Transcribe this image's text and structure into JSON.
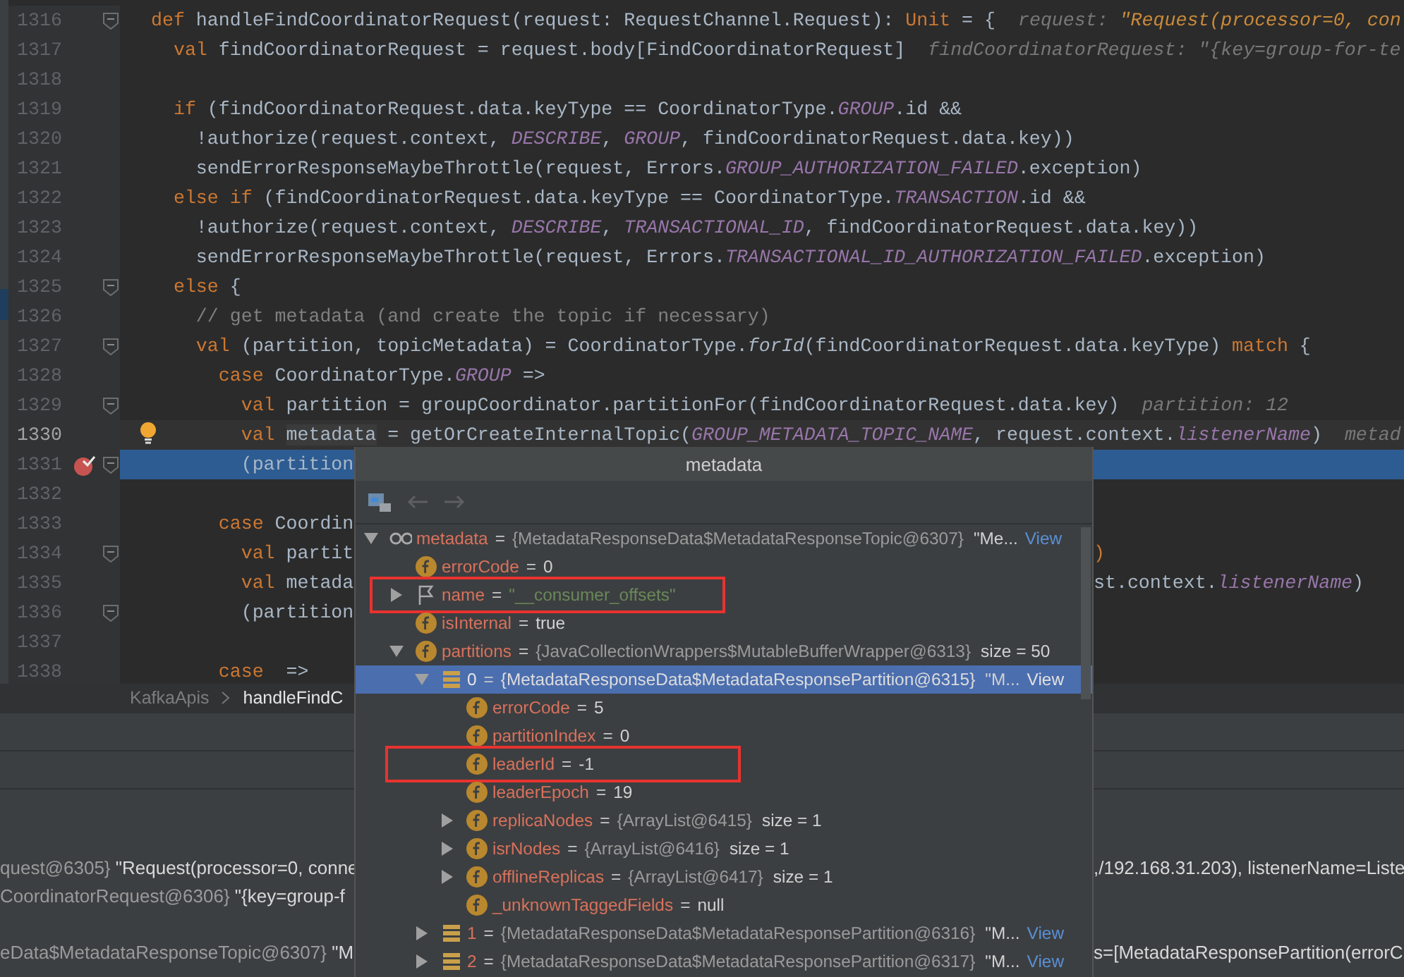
{
  "editor": {
    "lines": [
      {
        "number": "1316",
        "fold": true,
        "current_line": false,
        "execution_line": false,
        "breakpoint": false,
        "bulb": false,
        "tokens": [
          {
            "kind": "kw",
            "text": "def"
          },
          {
            "kind": "plain",
            "text": " handleFindCoordinatorRequest(request: RequestChannel.Request): "
          },
          {
            "kind": "kw",
            "text": "Unit"
          },
          {
            "kind": "plain",
            "text": " = {"
          }
        ],
        "hint": [
          {
            "kind": "hint",
            "text": "request: "
          },
          {
            "kind": "hint_value",
            "text": "\"Request(processor=0, con"
          }
        ]
      },
      {
        "number": "1317",
        "fold": false,
        "current_line": false,
        "execution_line": false,
        "breakpoint": false,
        "bulb": false,
        "tokens": [
          {
            "kind": "kw",
            "text": "  val"
          },
          {
            "kind": "plain",
            "text": " findCoordinatorRequest = request.body[FindCoordinatorRequest]"
          }
        ],
        "hint": [
          {
            "kind": "hint",
            "text": "findCoordinatorRequest: \"{key=group-for-te"
          }
        ]
      },
      {
        "number": "1318",
        "fold": false,
        "current_line": false,
        "execution_line": false,
        "breakpoint": false,
        "bulb": false
      },
      {
        "number": "1319",
        "fold": false,
        "current_line": false,
        "execution_line": false,
        "breakpoint": false,
        "bulb": false,
        "tokens": [
          {
            "kind": "kw",
            "text": "  if"
          },
          {
            "kind": "plain",
            "text": " (findCoordinatorRequest.data.keyType == CoordinatorType."
          },
          {
            "kind": "const",
            "text": "GROUP"
          },
          {
            "kind": "plain",
            "text": ".id &&"
          }
        ]
      },
      {
        "number": "1320",
        "fold": false,
        "current_line": false,
        "execution_line": false,
        "breakpoint": false,
        "bulb": false,
        "tokens": [
          {
            "kind": "plain",
            "text": "    !authorize(request.context, "
          },
          {
            "kind": "const",
            "text": "DESCRIBE"
          },
          {
            "kind": "plain",
            "text": ", "
          },
          {
            "kind": "const",
            "text": "GROUP"
          },
          {
            "kind": "plain",
            "text": ", findCoordinatorRequest.data.key))"
          }
        ]
      },
      {
        "number": "1321",
        "fold": false,
        "current_line": false,
        "execution_line": false,
        "breakpoint": false,
        "bulb": false,
        "tokens": [
          {
            "kind": "plain",
            "text": "    sendErrorResponseMaybeThrottle(request, Errors."
          },
          {
            "kind": "const",
            "text": "GROUP_AUTHORIZATION_FAILED"
          },
          {
            "kind": "plain",
            "text": ".exception)"
          }
        ]
      },
      {
        "number": "1322",
        "fold": false,
        "current_line": false,
        "execution_line": false,
        "breakpoint": false,
        "bulb": false,
        "tokens": [
          {
            "kind": "kw",
            "text": "  else if"
          },
          {
            "kind": "plain",
            "text": " (findCoordinatorRequest.data.keyType == CoordinatorType."
          },
          {
            "kind": "const",
            "text": "TRANSACTION"
          },
          {
            "kind": "plain",
            "text": ".id &&"
          }
        ]
      },
      {
        "number": "1323",
        "fold": false,
        "current_line": false,
        "execution_line": false,
        "breakpoint": false,
        "bulb": false,
        "tokens": [
          {
            "kind": "plain",
            "text": "    !authorize(request.context, "
          },
          {
            "kind": "const",
            "text": "DESCRIBE"
          },
          {
            "kind": "plain",
            "text": ", "
          },
          {
            "kind": "const",
            "text": "TRANSACTIONAL_ID"
          },
          {
            "kind": "plain",
            "text": ", findCoordinatorRequest.data.key))"
          }
        ]
      },
      {
        "number": "1324",
        "fold": false,
        "current_line": false,
        "execution_line": false,
        "breakpoint": false,
        "bulb": false,
        "tokens": [
          {
            "kind": "plain",
            "text": "    sendErrorResponseMaybeThrottle(request, Errors."
          },
          {
            "kind": "const",
            "text": "TRANSACTIONAL_ID_AUTHORIZATION_FAILED"
          },
          {
            "kind": "plain",
            "text": ".exception)"
          }
        ]
      },
      {
        "number": "1325",
        "fold": true,
        "current_line": false,
        "execution_line": false,
        "breakpoint": false,
        "bulb": false,
        "tokens": [
          {
            "kind": "kw",
            "text": "  else"
          },
          {
            "kind": "plain",
            "text": " {"
          }
        ]
      },
      {
        "number": "1326",
        "fold": false,
        "current_line": false,
        "execution_line": false,
        "breakpoint": false,
        "bulb": false,
        "tokens": [
          {
            "kind": "comment",
            "text": "    // get metadata (and create the topic if necessary)"
          }
        ]
      },
      {
        "number": "1327",
        "fold": true,
        "current_line": false,
        "execution_line": false,
        "breakpoint": false,
        "bulb": false,
        "tokens": [
          {
            "kind": "kw",
            "text": "    val"
          },
          {
            "kind": "plain",
            "text": " (partition, topicMetadata) = CoordinatorType."
          },
          {
            "kind": "italic",
            "text": "forId"
          },
          {
            "kind": "plain",
            "text": "(findCoordinatorRequest.data.keyType) "
          },
          {
            "kind": "kw",
            "text": "match"
          },
          {
            "kind": "plain",
            "text": " {"
          }
        ]
      },
      {
        "number": "1328",
        "fold": false,
        "current_line": false,
        "execution_line": false,
        "breakpoint": false,
        "bulb": false,
        "tokens": [
          {
            "kind": "kw",
            "text": "      case"
          },
          {
            "kind": "plain",
            "text": " CoordinatorType."
          },
          {
            "kind": "const",
            "text": "GROUP"
          },
          {
            "kind": "plain",
            "text": " =>"
          }
        ]
      },
      {
        "number": "1329",
        "fold": true,
        "current_line": false,
        "execution_line": false,
        "breakpoint": false,
        "bulb": false,
        "tokens": [
          {
            "kind": "kw",
            "text": "        val"
          },
          {
            "kind": "plain",
            "text": " partition = groupCoordinator.partitionFor(findCoordinatorRequest.data.key)"
          }
        ],
        "hint": [
          {
            "kind": "hint",
            "text": "partition: 12"
          }
        ]
      },
      {
        "number": "1330",
        "fold": false,
        "current_line": true,
        "execution_line": false,
        "breakpoint": false,
        "bulb": true,
        "tokens": [
          {
            "kind": "kw",
            "text": "        val "
          },
          {
            "kind": "usage",
            "text": "metadata"
          },
          {
            "kind": "plain",
            "text": " = getOrCreateInternalTopic("
          },
          {
            "kind": "const",
            "text": "GROUP_METADATA_TOPIC_NAME"
          },
          {
            "kind": "plain",
            "text": ", request.context."
          },
          {
            "kind": "const",
            "text": "listenerName"
          },
          {
            "kind": "plain",
            "text": ")"
          }
        ],
        "hint": [
          {
            "kind": "hint",
            "text": "metad"
          }
        ]
      },
      {
        "number": "1331",
        "fold": true,
        "current_line": false,
        "execution_line": true,
        "breakpoint": true,
        "bulb": false,
        "tokens": [
          {
            "kind": "plain",
            "text": "        (partition"
          }
        ]
      },
      {
        "number": "1332",
        "fold": false,
        "current_line": false,
        "execution_line": false,
        "breakpoint": false,
        "bulb": false
      },
      {
        "number": "1333",
        "fold": false,
        "current_line": false,
        "execution_line": false,
        "breakpoint": false,
        "bulb": false,
        "tokens": [
          {
            "kind": "kw",
            "text": "      case"
          },
          {
            "kind": "plain",
            "text": " Coordin"
          }
        ]
      },
      {
        "number": "1334",
        "fold": true,
        "current_line": false,
        "execution_line": false,
        "breakpoint": false,
        "bulb": false,
        "tokens": [
          {
            "kind": "kw",
            "text": "        val"
          },
          {
            "kind": "plain",
            "text": " partit"
          }
        ],
        "tokens_right": [
          {
            "kind": "kw",
            "text": ")"
          }
        ]
      },
      {
        "number": "1335",
        "fold": false,
        "current_line": false,
        "execution_line": false,
        "breakpoint": false,
        "bulb": false,
        "tokens": [
          {
            "kind": "kw",
            "text": "        val"
          },
          {
            "kind": "plain",
            "text": " metada"
          }
        ],
        "tokens_right": [
          {
            "kind": "plain",
            "text": "st.context."
          },
          {
            "kind": "const",
            "text": "listenerName"
          },
          {
            "kind": "plain",
            "text": ")"
          }
        ]
      },
      {
        "number": "1336",
        "fold": true,
        "current_line": false,
        "execution_line": false,
        "breakpoint": false,
        "bulb": false,
        "tokens": [
          {
            "kind": "plain",
            "text": "        (partition"
          }
        ]
      },
      {
        "number": "1337",
        "fold": false,
        "current_line": false,
        "execution_line": false,
        "breakpoint": false,
        "bulb": false
      },
      {
        "number": "1338",
        "fold": false,
        "current_line": false,
        "execution_line": false,
        "breakpoint": false,
        "bulb": false,
        "tokens": [
          {
            "kind": "kw",
            "text": "      case"
          },
          {
            "kind": "plain",
            "text": "  =>"
          }
        ]
      }
    ]
  },
  "breadcrumb": [
    {
      "text": "KafkaApis",
      "selected": false
    },
    {
      "text": "handleFindC",
      "selected": true
    }
  ],
  "variables": [
    {
      "left": [
        {
          "kind": "ref",
          "text": "quest@6305}"
        },
        {
          "kind": "str",
          "text": " \"Request(processor=0, conne"
        }
      ],
      "right": [
        {
          "kind": "str",
          "text": ",/192.168.31.203), listenerName=Liste"
        }
      ]
    },
    {
      "left": [
        {
          "kind": "ref",
          "text": "CoordinatorRequest@6306}"
        },
        {
          "kind": "str",
          "text": " \"{key=group-f"
        }
      ]
    },
    {
      "left": [
        {
          "kind": "ref",
          "text": "eData$MetadataResponseTopic@6307}"
        },
        {
          "kind": "str",
          "text": " \"M"
        }
      ],
      "right": [
        {
          "kind": "str",
          "text": "s=[MetadataResponsePartition(errorC"
        }
      ]
    }
  ],
  "popup": {
    "title": "metadata",
    "tree": [
      {
        "kind": "watch",
        "name": "metadata",
        "eq": "=",
        "ref": "{MetadataResponseData$MetadataResponseTopic@6307}",
        "value": "\"Me...",
        "link": "View",
        "expanded": true,
        "selected": false,
        "annotated": false,
        "children": [
          {
            "kind": "field",
            "name": "errorCode",
            "eq": "=",
            "value": "0",
            "selected": false,
            "annotated": false
          },
          {
            "kind": "flag",
            "name": "name",
            "eq": "=",
            "string": "\"__consumer_offsets\"",
            "expanded": false,
            "selected": false,
            "annotated": true
          },
          {
            "kind": "field",
            "name": "isInternal",
            "eq": "=",
            "value": "true",
            "selected": false,
            "annotated": false
          },
          {
            "kind": "field",
            "name": "partitions",
            "eq": "=",
            "ref": "{JavaCollectionWrappers$MutableBufferWrapper@6313}",
            "value": "size = 50",
            "expanded": true,
            "selected": false,
            "annotated": false,
            "children": [
              {
                "kind": "element",
                "name": "0",
                "eq": "=",
                "ref": "{MetadataResponseData$MetadataResponsePartition@6315}",
                "value": "\"M...",
                "link": "View",
                "expanded": true,
                "selected": true,
                "annotated": false,
                "children": [
                  {
                    "kind": "field",
                    "name": "errorCode",
                    "eq": "=",
                    "value": "5",
                    "selected": false,
                    "annotated": false
                  },
                  {
                    "kind": "field",
                    "name": "partitionIndex",
                    "eq": "=",
                    "value": "0",
                    "selected": false,
                    "annotated": false
                  },
                  {
                    "kind": "field",
                    "name": "leaderId",
                    "eq": "=",
                    "value": "-1",
                    "selected": false,
                    "annotated": true
                  },
                  {
                    "kind": "field",
                    "name": "leaderEpoch",
                    "eq": "=",
                    "value": "19",
                    "selected": false,
                    "annotated": false
                  },
                  {
                    "kind": "field",
                    "name": "replicaNodes",
                    "eq": "=",
                    "ref": "{ArrayList@6415}",
                    "value": "size = 1",
                    "expanded": false,
                    "selected": false,
                    "annotated": false
                  },
                  {
                    "kind": "field",
                    "name": "isrNodes",
                    "eq": "=",
                    "ref": "{ArrayList@6416}",
                    "value": "size = 1",
                    "expanded": false,
                    "selected": false,
                    "annotated": false
                  },
                  {
                    "kind": "field",
                    "name": "offlineReplicas",
                    "eq": "=",
                    "ref": "{ArrayList@6417}",
                    "value": "size = 1",
                    "expanded": false,
                    "selected": false,
                    "annotated": false
                  },
                  {
                    "kind": "field",
                    "name": "_unknownTaggedFields",
                    "eq": "=",
                    "value": "null",
                    "selected": false,
                    "annotated": false
                  }
                ]
              },
              {
                "kind": "element",
                "name": "1",
                "eq": "=",
                "ref": "{MetadataResponseData$MetadataResponsePartition@6316}",
                "value": "\"M...",
                "link": "View",
                "expanded": false,
                "selected": false,
                "annotated": false
              },
              {
                "kind": "element",
                "name": "2",
                "eq": "=",
                "ref": "{MetadataResponseData$MetadataResponsePartition@6317}",
                "value": "\"M...",
                "link": "View",
                "expanded": false,
                "selected": false,
                "annotated": false
              }
            ]
          }
        ]
      }
    ]
  }
}
